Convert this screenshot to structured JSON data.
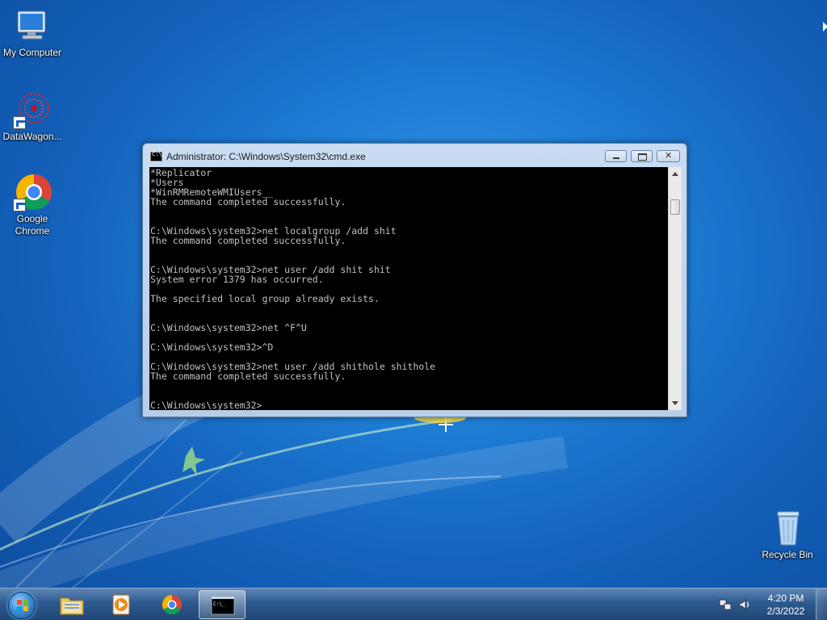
{
  "desktop": {
    "icons": [
      {
        "label": "My Computer",
        "icon": "computer-icon"
      },
      {
        "label": "DataWagon...",
        "icon": "datawagon-icon"
      },
      {
        "label": "Google Chrome",
        "icon": "chrome-icon"
      },
      {
        "label": "Recycle Bin",
        "icon": "recycle-bin-icon"
      }
    ]
  },
  "window": {
    "title": "Administrator: C:\\Windows\\System32\\cmd.exe",
    "console_lines": [
      "*Replicator",
      "*Users",
      "*WinRMRemoteWMIUsers__",
      "The command completed successfully.",
      "",
      "",
      "C:\\Windows\\system32>net localgroup /add shit",
      "The command completed successfully.",
      "",
      "",
      "C:\\Windows\\system32>net user /add shit shit",
      "System error 1379 has occurred.",
      "",
      "The specified local group already exists.",
      "",
      "",
      "C:\\Windows\\system32>net ^F^U",
      "",
      "C:\\Windows\\system32>^D",
      "",
      "C:\\Windows\\system32>net user /add shithole shithole",
      "The command completed successfully.",
      "",
      "",
      "C:\\Windows\\system32>"
    ]
  },
  "taskbar": {
    "items": [
      {
        "name": "explorer",
        "icon": "folder-icon"
      },
      {
        "name": "media-player",
        "icon": "media-player-icon"
      },
      {
        "name": "chrome",
        "icon": "chrome-icon"
      },
      {
        "name": "cmd",
        "icon": "cmd-icon",
        "active": true
      }
    ],
    "tray_icons": [
      "network-icon",
      "volume-icon"
    ],
    "time": "4:20 PM",
    "date": "2/3/2022"
  }
}
